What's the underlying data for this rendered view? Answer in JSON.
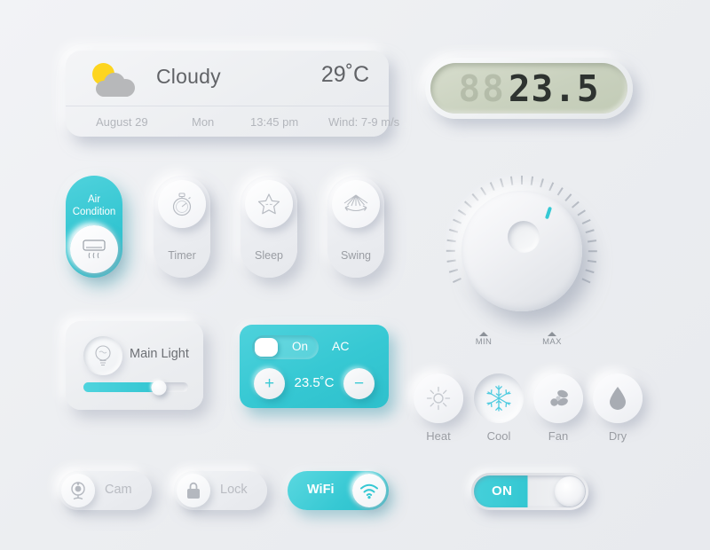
{
  "theme": {
    "accent": "#35c8d3",
    "accent_dark": "#2cbfcb",
    "background": "#edeff2",
    "text_dark": "#616367",
    "text_muted": "#9a9da3",
    "lcd_screen": "#c9d1be",
    "lcd_digit": "#2e3330",
    "sun_yellow": "#fdd51f",
    "cloud_grey": "#b7b8ba"
  },
  "weather": {
    "condition": "Cloudy",
    "temperature": "29˚C",
    "icon": "sun-behind-cloud-icon",
    "date": "August 29",
    "day": "Mon",
    "time": "13:45 pm",
    "wind": "Wind: 7-9 m/s"
  },
  "lcd": {
    "inactive_digits": "88",
    "value": "23.5"
  },
  "modes": [
    {
      "label": "Air Condition",
      "label_line1": "Air",
      "label_line2": "Condition",
      "icon": "air-conditioner-icon",
      "active": true
    },
    {
      "label": "Timer",
      "icon": "stopwatch-icon",
      "active": false
    },
    {
      "label": "Sleep",
      "icon": "sleeping-star-icon",
      "active": false
    },
    {
      "label": "Swing",
      "icon": "swing-airflow-icon",
      "active": false
    }
  ],
  "main_light": {
    "label": "Main Light",
    "icon": "lightbulb-icon",
    "slider_percent": 72
  },
  "ac_panel": {
    "toggle_label": "On",
    "title": "AC",
    "plus_label": "+",
    "minus_label": "−",
    "temperature": "23.5˚C",
    "toggle_on": true
  },
  "knob": {
    "min_label": "MIN",
    "max_label": "MAX",
    "indicator_color": "#35c9d4",
    "tick_count": 44
  },
  "hvac_modes": [
    {
      "label": "Heat",
      "icon": "sun-icon",
      "active": false
    },
    {
      "label": "Cool",
      "icon": "snowflake-icon",
      "active": true
    },
    {
      "label": "Fan",
      "icon": "fan-blades-icon",
      "active": false
    },
    {
      "label": "Dry",
      "icon": "water-drop-icon",
      "active": false
    }
  ],
  "quick_toggles": [
    {
      "label": "Cam",
      "icon": "webcam-icon",
      "active": false,
      "icon_side": "left"
    },
    {
      "label": "Lock",
      "icon": "padlock-icon",
      "active": false,
      "icon_side": "left"
    },
    {
      "label": "WiFi",
      "icon": "wifi-icon",
      "active": true,
      "icon_side": "right"
    }
  ],
  "power_switch": {
    "label": "ON",
    "state": true
  }
}
